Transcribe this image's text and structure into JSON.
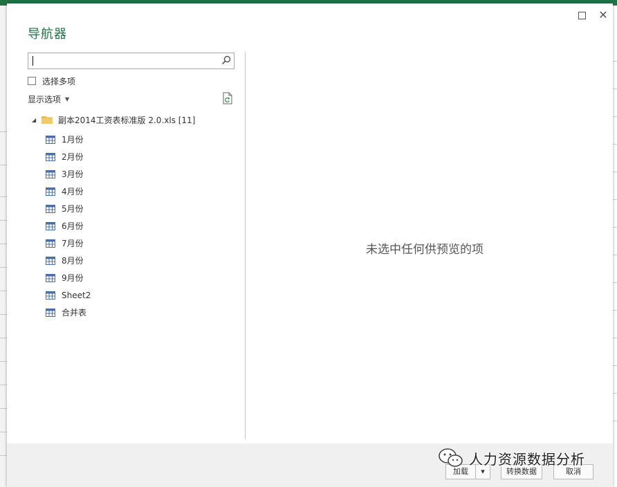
{
  "dialog": {
    "title": "导航器",
    "search": {
      "value": "",
      "placeholder": ""
    },
    "select_multiple_label": "选择多项",
    "display_options_label": "显示选项",
    "tree": {
      "root_label": "副本2014工资表标准版 2.0.xls [11]",
      "items": [
        "1月份",
        "2月份",
        "3月份",
        "4月份",
        "5月份",
        "6月份",
        "7月份",
        "8月份",
        "9月份",
        "Sheet2",
        "合并表"
      ]
    },
    "preview_empty_message": "未选中任何供预览的项",
    "buttons": {
      "load": "加载",
      "load_dropdown": "▾",
      "transform": "转换数据",
      "cancel": "取消"
    }
  },
  "watermark": {
    "text": "人力资源数据分析"
  },
  "colors": {
    "accent": "#217346",
    "footer": "#f0f0f0",
    "folder": "#e8b84b",
    "table_icon": "#4a6fa5"
  }
}
